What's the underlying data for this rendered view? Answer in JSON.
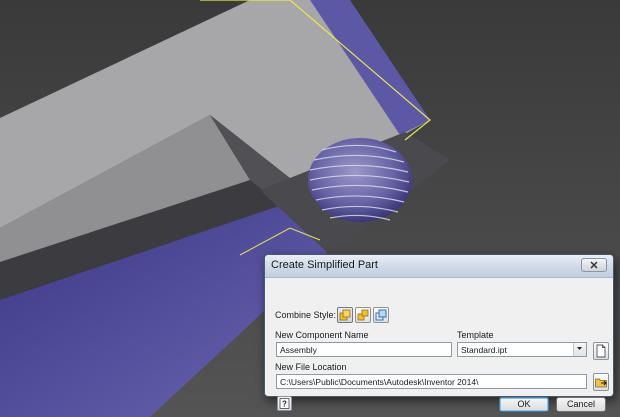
{
  "dialog": {
    "title": "Create Simplified Part",
    "combine_style_label": "Combine Style:",
    "combine_style_buttons": [
      {
        "icon": "combine-single-solid-icon",
        "selected": true
      },
      {
        "icon": "combine-multiple-solids-icon",
        "selected": false
      },
      {
        "icon": "combine-surfaces-icon",
        "selected": false
      }
    ],
    "component_name_label": "New Component Name",
    "component_name_value": "Assembly",
    "template_label": "Template",
    "template_value": "Standard.ipt",
    "file_location_label": "New File Location",
    "file_location_value": "C:\\Users\\Public\\Documents\\Autodesk\\Inventor 2014\\",
    "ok_label": "OK",
    "cancel_label": "Cancel"
  },
  "colors": {
    "viewport_background": "#444444",
    "part_gray": "#a6a6a8",
    "part_blue": "#5b56a0",
    "edge_highlight": "#e8e84c"
  }
}
